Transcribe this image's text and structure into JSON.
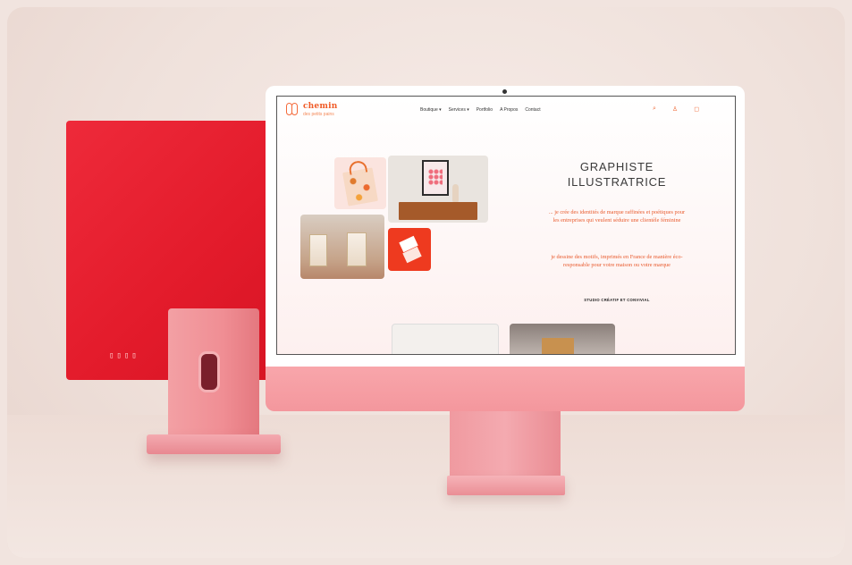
{
  "site": {
    "logo_word": "chemin",
    "logo_tagline": "des petits pains",
    "menu": [
      "Boutique ▾",
      "Services ▾",
      "Portfolio",
      "A Propos",
      "Contact"
    ],
    "nav_icons": [
      "search-icon",
      "user-icon",
      "cart-icon"
    ]
  },
  "hero": {
    "title_line1": "GRAPHISTE",
    "title_line2": "ILLUSTRATRICE",
    "para1": "... je crée des identités de marque raffinées et poétiques pour les entreprises qui veulent séduire une clientèle féminine",
    "para2": "je dessine des motifs, imprimés en France de manière éco-responsable pour votre maison ou votre marque",
    "studio": "STUDIO CRÉATIF ET CONVIVIAL"
  },
  "colors": {
    "accent": "#f05a26",
    "imac_back": "#e31b2b",
    "imac_front": "#f4979d"
  }
}
